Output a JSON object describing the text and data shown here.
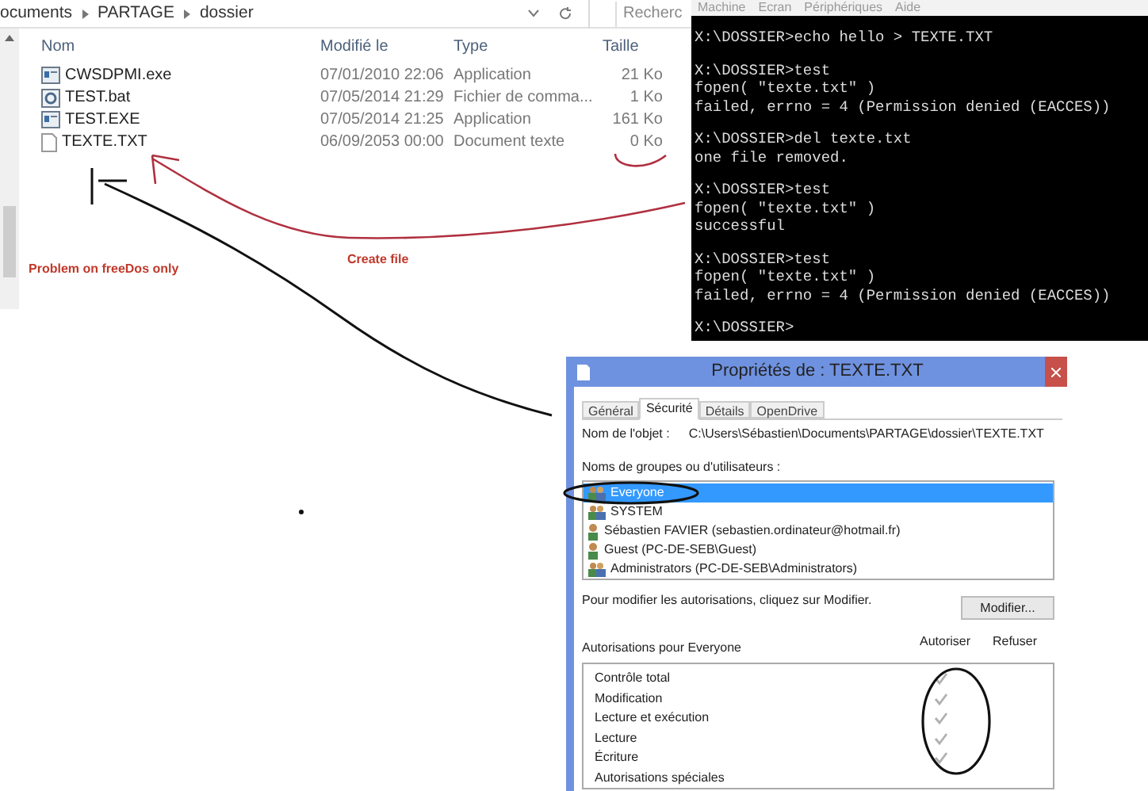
{
  "explorer": {
    "breadcrumb": [
      "ocuments",
      "PARTAGE",
      "dossier"
    ],
    "search": {
      "placeholder": "Recherc"
    },
    "columns": [
      "Nom",
      "Modifié le",
      "Type",
      "Taille"
    ],
    "files": [
      {
        "kind": "exe",
        "name": "CWSDPMI.exe",
        "modified": "07/01/2010 22:06",
        "type": "Application",
        "size": "21 Ko"
      },
      {
        "kind": "bat",
        "name": "TEST.bat",
        "modified": "07/05/2014 21:29",
        "type": "Fichier de comma...",
        "size": "1 Ko"
      },
      {
        "kind": "exe",
        "name": "TEST.EXE",
        "modified": "07/05/2014 21:25",
        "type": "Application",
        "size": "161 Ko"
      },
      {
        "kind": "txt",
        "name": "TEXTE.TXT",
        "modified": "06/09/2053 00:00",
        "type": "Document texte",
        "size": "0 Ko"
      }
    ]
  },
  "terminal": {
    "menu": [
      "Machine",
      "Ecran",
      "Périphériques",
      "Aide"
    ],
    "blocks": [
      [
        "X:\\DOSSIER>echo hello > TEXTE.TXT"
      ],
      [
        "X:\\DOSSIER>test",
        "fopen( \"texte.txt\" )",
        "failed, errno = 4 (Permission denied (EACCES))"
      ],
      [
        "X:\\DOSSIER>del texte.txt",
        "one file removed."
      ],
      [
        "X:\\DOSSIER>test",
        "fopen( \"texte.txt\" )",
        "successful"
      ],
      [
        "X:\\DOSSIER>test",
        "fopen( \"texte.txt\" )",
        "failed, errno = 4 (Permission denied (EACCES))"
      ],
      [
        "X:\\DOSSIER>"
      ]
    ]
  },
  "dialog": {
    "title": "Propriétés de : TEXTE.TXT",
    "tabs": [
      {
        "label": "Général",
        "selected": false
      },
      {
        "label": "Sécurité",
        "selected": true
      },
      {
        "label": "Détails",
        "selected": false
      },
      {
        "label": "OpenDrive",
        "selected": false
      }
    ],
    "object_label": "Nom de l'objet :",
    "object_path": "C:\\Users\\Sébastien\\Documents\\PARTAGE\\dossier\\TEXTE.TXT",
    "groups_label": "Noms de groupes ou d'utilisateurs :",
    "users": [
      {
        "kind": "group",
        "name": "Everyone",
        "selected": true
      },
      {
        "kind": "group",
        "name": "SYSTEM",
        "selected": false
      },
      {
        "kind": "user",
        "name": "Sébastien FAVIER (sebastien.ordinateur@hotmail.fr)",
        "selected": false
      },
      {
        "kind": "user",
        "name": "Guest (PC-DE-SEB\\Guest)",
        "selected": false
      },
      {
        "kind": "group",
        "name": "Administrators (PC-DE-SEB\\Administrators)",
        "selected": false
      }
    ],
    "modify_note": "Pour modifier les autorisations, cliquez sur Modifier.",
    "modify_button": "Modifier...",
    "permissions_label": "Autorisations pour Everyone",
    "permission_columns": [
      "Autoriser",
      "Refuser"
    ],
    "permissions": [
      {
        "name": "Contrôle total",
        "allow": true,
        "deny": false
      },
      {
        "name": "Modification",
        "allow": true,
        "deny": false
      },
      {
        "name": "Lecture et exécution",
        "allow": true,
        "deny": false
      },
      {
        "name": "Lecture",
        "allow": true,
        "deny": false
      },
      {
        "name": "Écriture",
        "allow": true,
        "deny": false
      },
      {
        "name": "Autorisations spéciales",
        "allow": false,
        "deny": false
      }
    ]
  },
  "annotations": {
    "problem_note": "Problem on freeDos only",
    "create_note": "Create file"
  }
}
